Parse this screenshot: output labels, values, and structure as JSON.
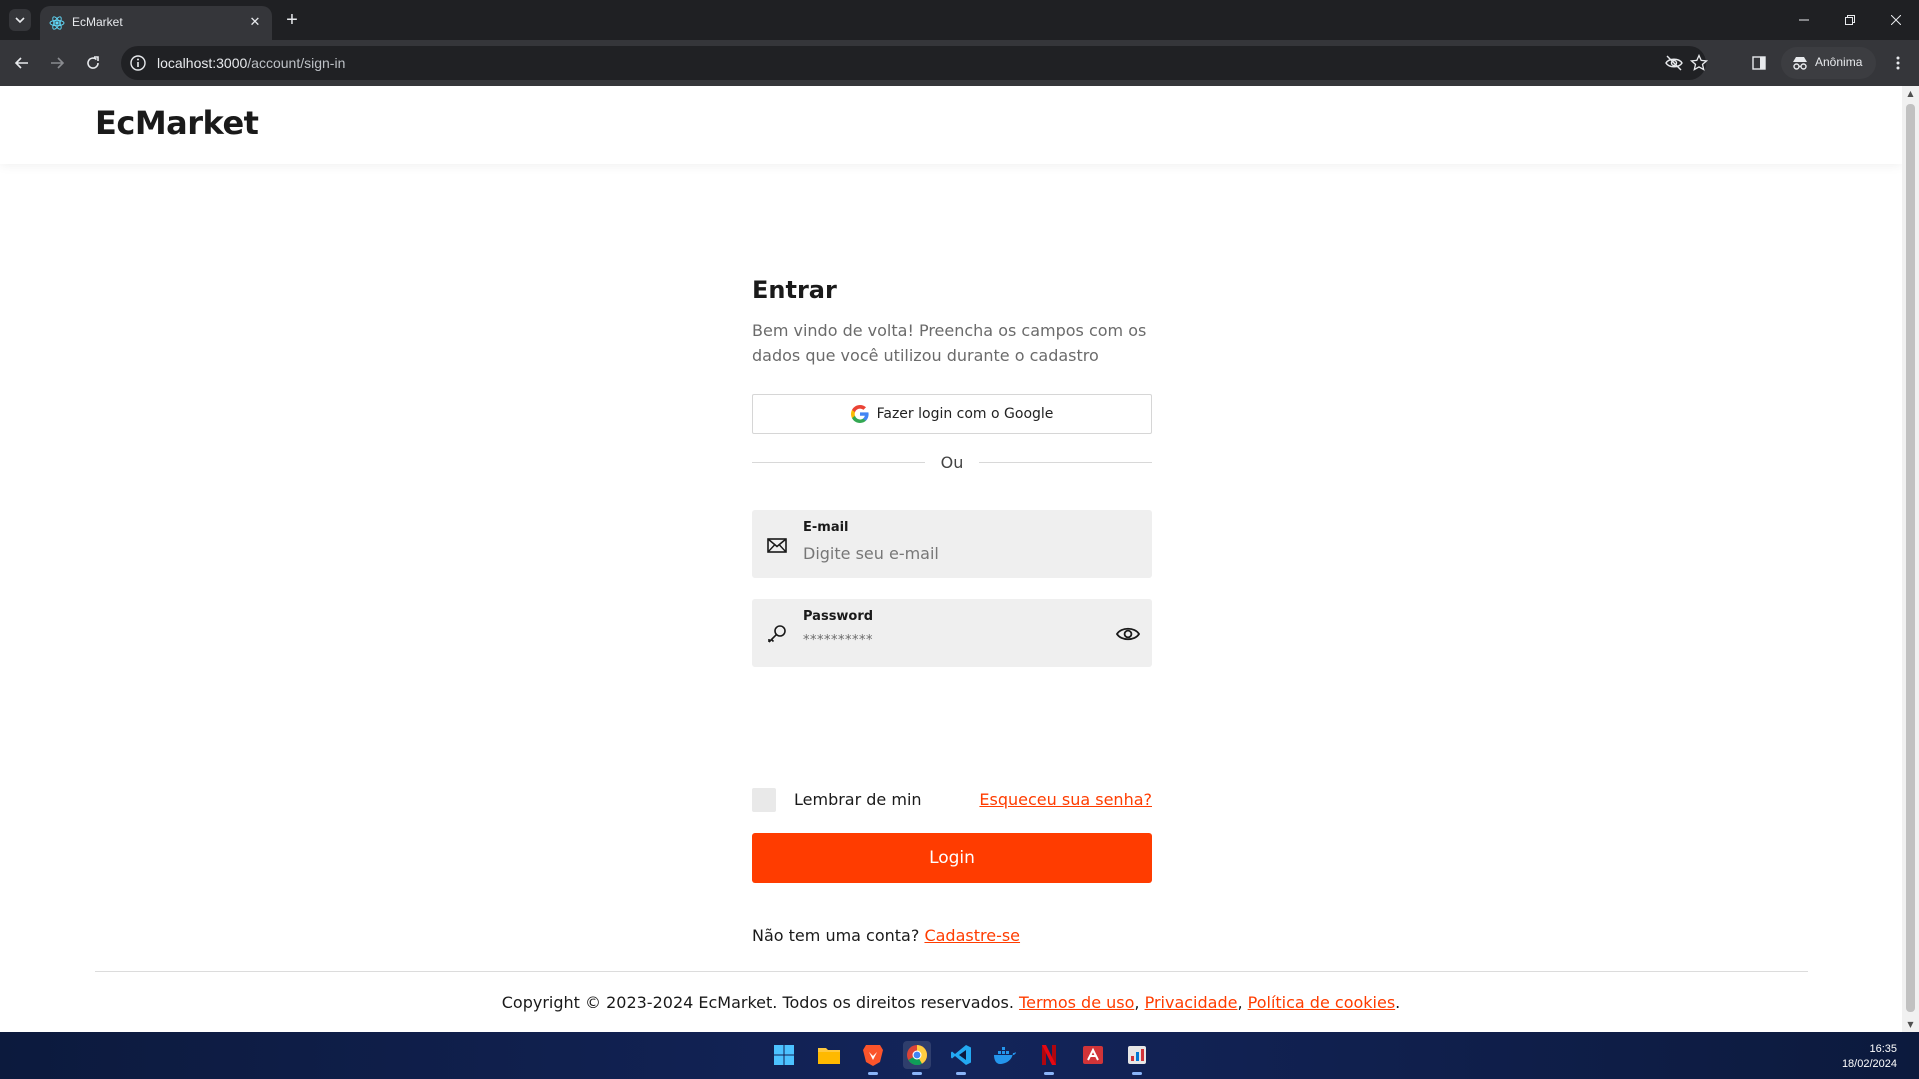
{
  "browser": {
    "tab_title": "EcMarket",
    "url_host": "localhost:3000",
    "url_path": "/account/sign-in",
    "profile_label": "Anônima"
  },
  "site": {
    "brand": "EcMarket"
  },
  "login": {
    "title": "Entrar",
    "subtitle": "Bem vindo de volta! Preencha os campos com os dados que você utilizou durante o cadastro",
    "google_button": "Fazer login com o Google",
    "divider_text": "Ou",
    "email": {
      "label": "E-mail",
      "placeholder": "Digite seu e-mail"
    },
    "password": {
      "label": "Password",
      "masked_value": "**********"
    },
    "remember_label": "Lembrar de min",
    "forgot_link": "Esqueceu sua senha?",
    "submit_label": "Login",
    "signup_prompt": "Não tem uma conta?",
    "signup_link": "Cadastre-se"
  },
  "footer": {
    "copyright": "Copyright © 2023-2024 EcMarket. Todos os direitos reservados.",
    "terms_link": "Termos de uso",
    "privacy_link": "Privacidade",
    "cookies_link": "Política de cookies",
    "sep1": ",",
    "sep2": ",",
    "end": "."
  },
  "taskbar": {
    "time": "16:35",
    "date": "18/02/2024",
    "apps": [
      "windows-start",
      "file-explorer",
      "brave",
      "chrome",
      "vscode",
      "docker",
      "netflix",
      "office",
      "task-manager"
    ]
  },
  "colors": {
    "accent": "#ff3c00",
    "field_bg": "#efefef",
    "chrome_dark": "#35363a"
  }
}
